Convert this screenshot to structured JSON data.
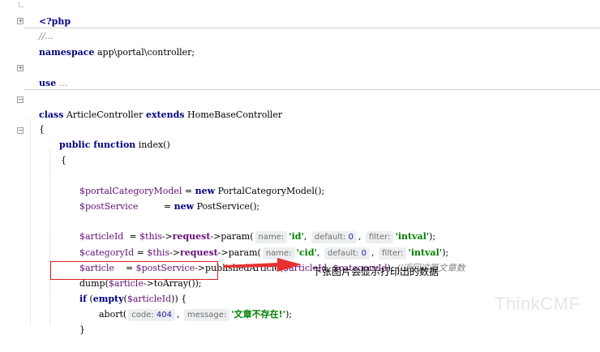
{
  "editor": {
    "lines": {
      "php_open": "<?php",
      "fold_comment": "//...",
      "namespace_kw": "namespace",
      "namespace_rest": " app\\portal\\controller;",
      "use_kw": "use",
      "use_rest": " ...",
      "class_kw": "class",
      "class_name": " ArticleController ",
      "extends_kw": "extends",
      "class_parent": " HomeBaseController",
      "brace_open": "{",
      "public_kw": "public",
      "function_kw": " function",
      "method_name": " index()",
      "method_brace_open": "{",
      "l1_var": "$portalCategoryModel",
      "l1_eq": " = ",
      "l1_new": "new",
      "l1_rest": " PortalCategoryModel();",
      "l2_var": "$postService",
      "l2_eq": "         = ",
      "l2_new": "new",
      "l2_rest": " PostService();",
      "l3_var": "$articleId",
      "l3_eq": "  = ",
      "l3_this": "$this",
      "l3_arrow": "->",
      "l3_req": "request",
      "l3_call": "->param(",
      "l3_hint_name": "name:",
      "l3_str1": "'id'",
      "l3_comma": ", ",
      "l3_hint_default": "default:",
      "l3_num": "0",
      "l3_comma2": ", ",
      "l3_hint_filter": "filter:",
      "l3_str2": "'intval'",
      "l3_end": ");",
      "l4_var": "$categoryId",
      "l4_eq": " = ",
      "l4_this": "$this",
      "l4_arrow": "->",
      "l4_req": "request",
      "l4_call": "->param(",
      "l4_hint_name": "name:",
      "l4_str1": "'cid'",
      "l4_comma": ", ",
      "l4_hint_default": "default:",
      "l4_num": "0",
      "l4_comma2": ", ",
      "l4_hint_filter": "filter:",
      "l4_str2": "'intval'",
      "l4_end": ");",
      "l5_var": "$article",
      "l5_eq": "    = ",
      "l5_svc": "$postService",
      "l5_call": "->publishedArticle(",
      "l5_arg1": "$articleId",
      "l5_comma": ", ",
      "l5_arg2": "$categoryId",
      "l5_end": "); ",
      "l5_comment": "//返回这篇文章数",
      "l6_pre": "dump(",
      "l6_var": "$article",
      "l6_rest": "->toArray());",
      "l7_if": "if",
      "l7_open": " (",
      "l7_empty": "empty",
      "l7_paren": "(",
      "l7_var": "$articleId",
      "l7_close": ")) {",
      "l8_pre": "abort(",
      "l8_hint_code": "code:",
      "l8_num": "404",
      "l8_comma": ", ",
      "l8_hint_msg": "message:",
      "l8_str": "'文章不存在!'",
      "l8_end": ");",
      "l9_brace": "}"
    }
  },
  "annotation": "下张图片会显示打印出的数据",
  "watermark": "ThinkCMF",
  "colors": {
    "keyword": "#000080",
    "variable": "#660e7a",
    "string": "#008000",
    "number": "#0000ff",
    "comment": "#808080",
    "highlight_box": "#e02020",
    "arrow": "#e83030"
  },
  "icons": [
    "fold-expand-icon",
    "fold-collapse-icon",
    "red-arrow-icon"
  ]
}
